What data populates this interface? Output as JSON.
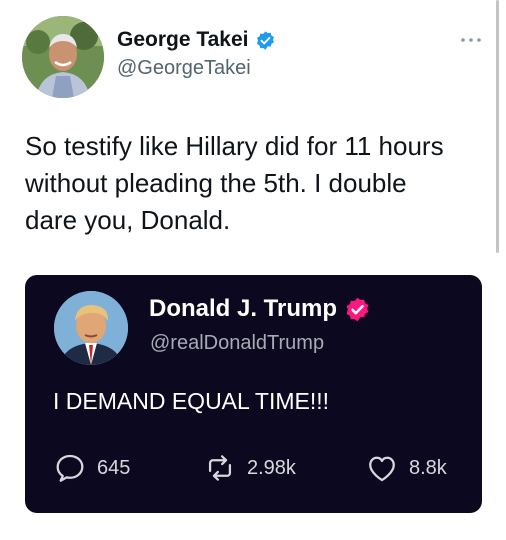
{
  "tweet": {
    "author": {
      "name": "George Takei",
      "handle": "@GeorgeTakei",
      "verified": true
    },
    "text": "So testify like Hillary did for 11 hours without pleading the 5th. I double dare you, Donald.",
    "more_icon": "more-horizontal-icon"
  },
  "quoted_tweet": {
    "author": {
      "name": "Donald J. Trump",
      "handle": "@realDonaldTrump",
      "verified": true
    },
    "text": "I DEMAND EQUAL TIME!!!",
    "stats": {
      "replies": "645",
      "retweets": "2.98k",
      "likes": "8.8k"
    },
    "theme": "dark"
  },
  "colors": {
    "verified_blue": "#1d9bf0",
    "verified_pink": "#f91880",
    "quote_background": "#0c0820",
    "secondary_text": "#536471"
  }
}
